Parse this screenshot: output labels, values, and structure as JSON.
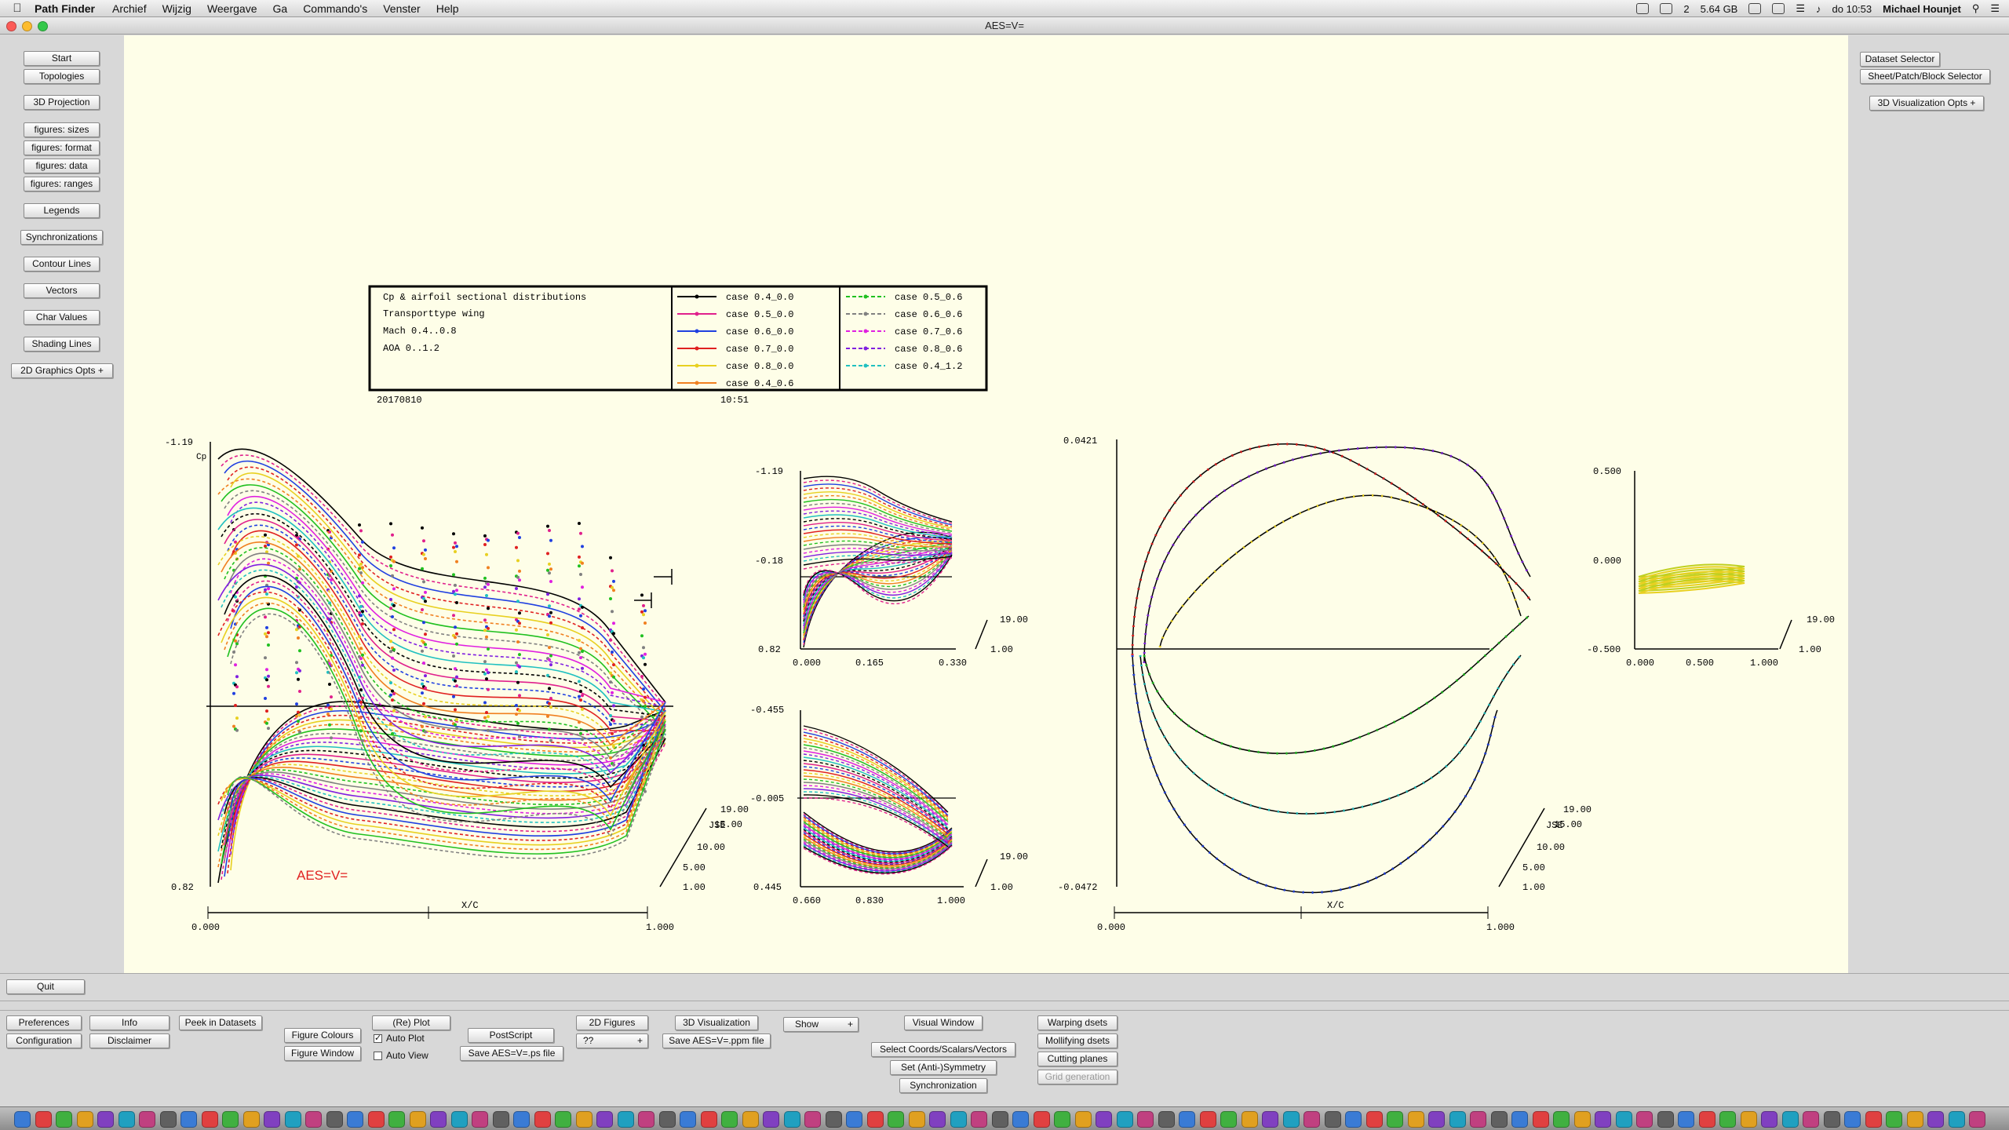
{
  "menubar": {
    "app_name": "Path Finder",
    "items": [
      "Archief",
      "Wijzig",
      "Weergave",
      "Ga",
      "Commando's",
      "Venster",
      "Help"
    ],
    "status_count": "2",
    "memory": "5.64 GB",
    "clock": "do 10:53",
    "user": "Michael Hounjet"
  },
  "window": {
    "title": "AES=V="
  },
  "left_panel": {
    "buttons": [
      "Start",
      "Topologies",
      "3D Projection",
      "figures: sizes",
      "figures: format",
      "figures: data",
      "figures: ranges",
      "Legends",
      "Synchronizations",
      "Contour Lines",
      "Vectors",
      "Char Values",
      "Shading Lines",
      "2D Graphics Opts  +"
    ]
  },
  "right_panel": {
    "buttons": [
      "Dataset Selector",
      "Sheet/Patch/Block Selector",
      "3D Visualization Opts  +"
    ]
  },
  "legend": {
    "title_lines": [
      "Cp & airfoil sectional distributions",
      "Transporttype wing",
      "Mach 0.4..0.8",
      "AOA 0..1.2"
    ],
    "cases_left": [
      "case 0.4_0.0",
      "case 0.5_0.0",
      "case 0.6_0.0",
      "case 0.7_0.0",
      "case 0.8_0.0",
      "case 0.4_0.6"
    ],
    "cases_right": [
      "case 0.5_0.6",
      "case 0.6_0.6",
      "case 0.7_0.6",
      "case 0.8_0.6",
      "case 0.4_1.2"
    ],
    "date": "20170810",
    "time": "10:51",
    "colors_left": [
      "#000000",
      "#e0208c",
      "#2040e0",
      "#e02020",
      "#e8d020",
      "#f08020"
    ],
    "colors_right": [
      "#20c020",
      "#808080",
      "#e020e0",
      "#8020e0",
      "#20c0c0"
    ]
  },
  "plots": {
    "main_cp": {
      "y_top": "-1.19",
      "y_bottom": "0.82",
      "y_label": "Cp",
      "x_left": "0.000",
      "x_right": "1.000",
      "x_label": "X/C",
      "z_ticks": [
        "19.00",
        "15.00",
        "10.00",
        "5.00",
        "1.00"
      ],
      "z_label": "JSE",
      "annotation": "AES=V="
    },
    "upper_small": {
      "y_ticks": [
        "-1.19",
        "-0.18",
        "0.82"
      ],
      "x_ticks": [
        "0.000",
        "0.165",
        "0.330"
      ],
      "z_ticks": [
        "19.00",
        "1.00"
      ]
    },
    "lower_small": {
      "y_ticks": [
        "-0.455",
        "-0.005",
        "0.445"
      ],
      "x_ticks": [
        "0.660",
        "0.830",
        "1.000"
      ],
      "z_ticks": [
        "19.00",
        "1.00"
      ]
    },
    "airfoil": {
      "y_top": "0.0421",
      "y_bottom": "-0.0472",
      "x_left": "0.000",
      "x_right": "1.000",
      "x_label": "X/C",
      "z_ticks": [
        "19.00",
        "15.00",
        "10.00",
        "5.00",
        "1.00"
      ],
      "z_label": "JSE"
    },
    "thumb": {
      "y_ticks": [
        "0.500",
        "0.000",
        "-0.500"
      ],
      "x_ticks": [
        "0.000",
        "0.500",
        "1.000"
      ],
      "z_ticks": [
        "19.00",
        "1.00"
      ]
    }
  },
  "bottom": {
    "quit": "Quit",
    "preferences": "Preferences",
    "configuration": "Configuration",
    "info": "Info",
    "disclaimer": "Disclaimer",
    "peek": "Peek in Datasets",
    "figure_colours": "Figure Colours",
    "figure_window": "Figure Window",
    "replot": "(Re) Plot",
    "auto_plot": "Auto Plot",
    "auto_plot_checked": true,
    "auto_view": "Auto View",
    "postscript": "PostScript",
    "save_ps": "Save AES=V=.ps file",
    "figures_2d": "2D Figures",
    "select_qq": "??",
    "viz_3d": "3D Visualization",
    "save_ppm": "Save AES=V=.ppm file",
    "show": "Show",
    "visual_window": "Visual Window",
    "select_coords": "Select Coords/Scalars/Vectors",
    "set_symmetry": "Set    (Anti-)Symmetry",
    "synchronization": "Synchronization",
    "warping": "Warping     dsets",
    "mollifying": "Mollifying dsets",
    "cutting": "Cutting planes",
    "grid_generation": "Grid generation"
  }
}
